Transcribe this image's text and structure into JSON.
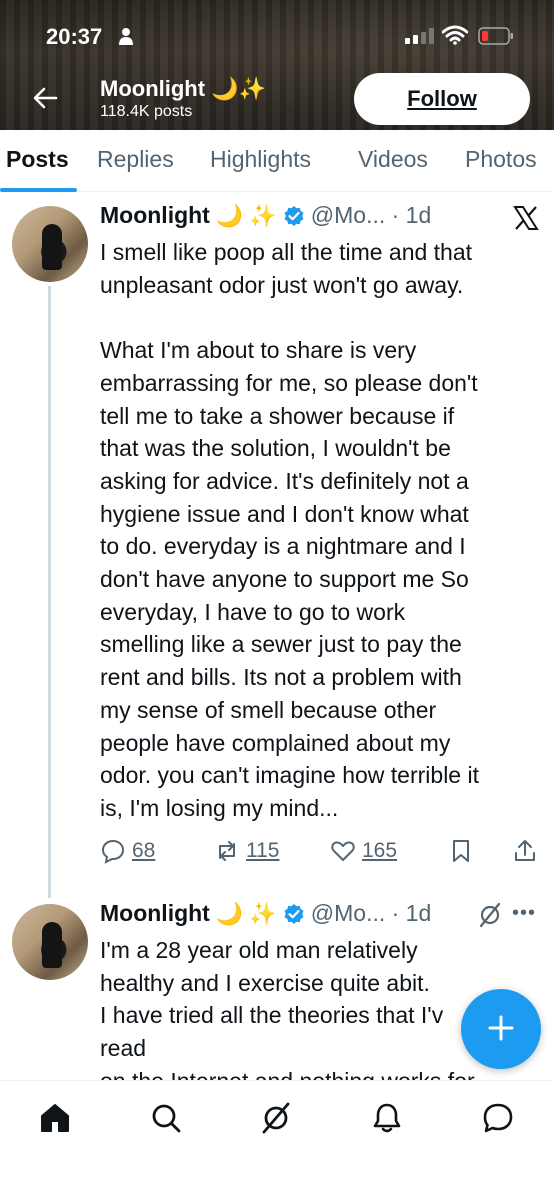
{
  "status_bar": {
    "time": "20:37"
  },
  "profile": {
    "name": "Moonlight",
    "name_emoji": "🌙✨",
    "post_count": "118.4K posts",
    "follow_label": "Follow"
  },
  "tabs": [
    {
      "label": "Posts",
      "active": true
    },
    {
      "label": "Replies"
    },
    {
      "label": "Highlights"
    },
    {
      "label": "Videos"
    },
    {
      "label": "Photos"
    }
  ],
  "posts": [
    {
      "author": "Moonlight",
      "emoji": "🌙 ✨",
      "handle": "@Mo... · 1d",
      "body": "I smell like poop all the time and that\nunpleasant odor just won't go away.\n\nWhat I'm about to share is very\nembarrassing for me, so please don't\ntell me to take a shower because if\nthat was the solution, I wouldn't be\nasking for advice. It's definitely not a\nhygiene issue and I don't know what\nto do. everyday is a nightmare and I\ndon't have anyone to support me So\neveryday, I have to go to work\nsmelling like a sewer just to pay the\nrent and bills. Its not a problem with\nmy sense of smell because other\npeople have complained about my\nodor. you can't imagine how terrible it\nis, I'm losing my mind...",
      "replies": "68",
      "reposts": "115",
      "likes": "165"
    },
    {
      "author": "Moonlight",
      "emoji": "🌙 ✨",
      "handle": "@Mo... · 1d",
      "body": "I'm a 28 year old man relatively\nhealthy and I exercise quite abit.\nI have tried all the theories that I'v\nread\non the Internet and nothing works for"
    }
  ],
  "colors": {
    "accent": "#1d9bf0",
    "text": "#0f1419",
    "muted": "#536471"
  },
  "icons": {
    "back": "arrow-left-icon",
    "verified": "verified-badge-icon",
    "x": "x-logo-icon",
    "reply": "reply-icon",
    "repost": "repost-icon",
    "like": "heart-icon",
    "bookmark": "bookmark-icon",
    "share": "share-icon",
    "nav": [
      "home-icon",
      "search-icon",
      "grok-icon",
      "notifications-icon",
      "messages-icon"
    ]
  }
}
